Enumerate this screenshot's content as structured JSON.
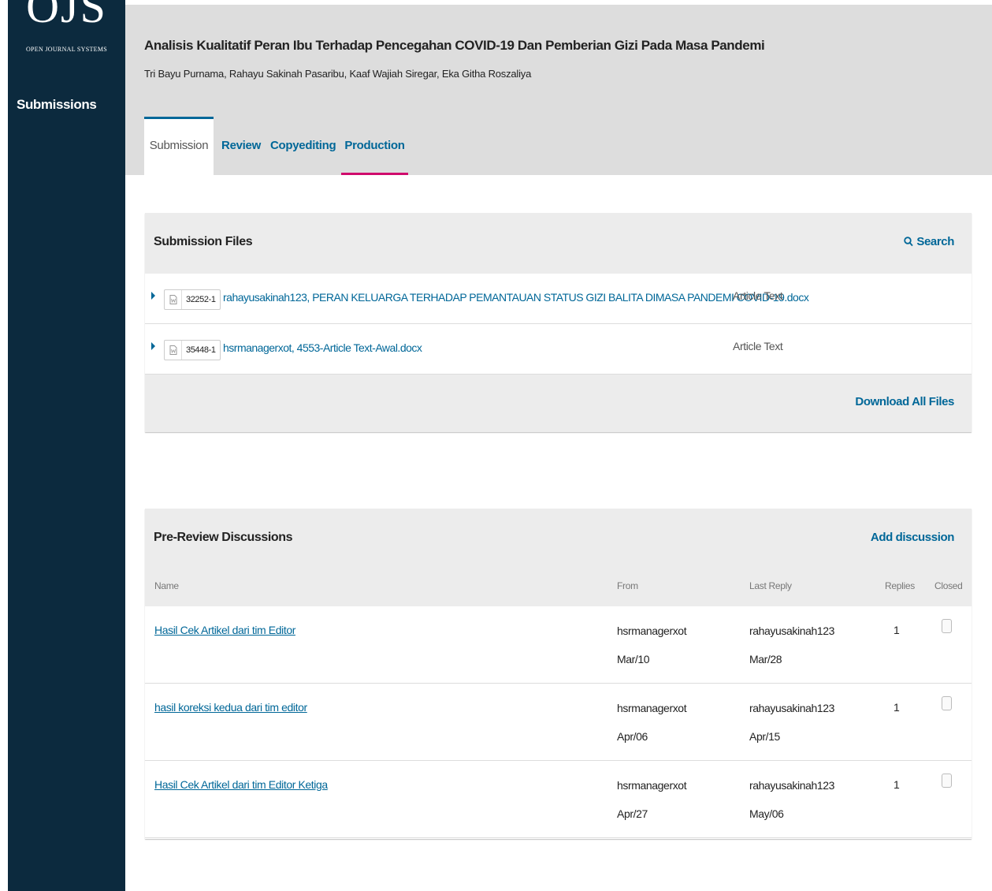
{
  "sidebar": {
    "logo_mark": "OJS",
    "logo_subtitle": "OPEN JOURNAL SYSTEMS",
    "nav_submissions": "Submissions"
  },
  "header": {
    "title": "Analisis Kualitatif Peran Ibu Terhadap Pencegahan COVID-19 Dan Pemberian Gizi Pada Masa Pandemi",
    "authors": "Tri Bayu Purnama, Rahayu Sakinah Pasaribu, Kaaf Wajiah Siregar, Eka Githa Roszaliya"
  },
  "tabs": [
    {
      "label": "Submission",
      "active": true
    },
    {
      "label": "Review",
      "active": false
    },
    {
      "label": "Copyediting",
      "active": false
    },
    {
      "label": "Production",
      "active": false
    }
  ],
  "files_panel": {
    "title": "Submission Files",
    "search_label": "Search",
    "download_all_label": "Download All Files",
    "files": [
      {
        "id": "32252-1",
        "name": "rahayusakinah123, PERAN KELUARGA TERHADAP PEMANTAUAN STATUS GIZI BALITA DIMASA PANDEMI COVID-19.docx",
        "type": "Article Text"
      },
      {
        "id": "35448-1",
        "name": "hsrmanagerxot, 4553-Article Text-Awal.docx",
        "type": "Article Text"
      }
    ]
  },
  "discussions_panel": {
    "title": "Pre-Review Discussions",
    "add_label": "Add discussion",
    "columns": {
      "name": "Name",
      "from": "From",
      "last_reply": "Last Reply",
      "replies": "Replies",
      "closed": "Closed"
    },
    "rows": [
      {
        "name": "Hasil Cek Artikel dari tim Editor",
        "from_user": "hsrmanagerxot",
        "from_date": "Mar/10",
        "reply_user": "rahayusakinah123",
        "reply_date": "Mar/28",
        "replies": "1",
        "closed": false
      },
      {
        "name": "hasil koreksi kedua dari tim editor",
        "from_user": "hsrmanagerxot",
        "from_date": "Apr/06",
        "reply_user": "rahayusakinah123",
        "reply_date": "Apr/15",
        "replies": "1",
        "closed": false
      },
      {
        "name": "Hasil Cek Artikel dari tim Editor Ketiga",
        "from_user": "hsrmanagerxot",
        "from_date": "Apr/27",
        "reply_user": "rahayusakinah123",
        "reply_date": "May/06",
        "replies": "1",
        "closed": false
      }
    ]
  },
  "colors": {
    "sidebar_bg": "#0c2a3e",
    "link": "#006798",
    "production_underline": "#d00a6c",
    "header_bg": "#dddddd"
  }
}
